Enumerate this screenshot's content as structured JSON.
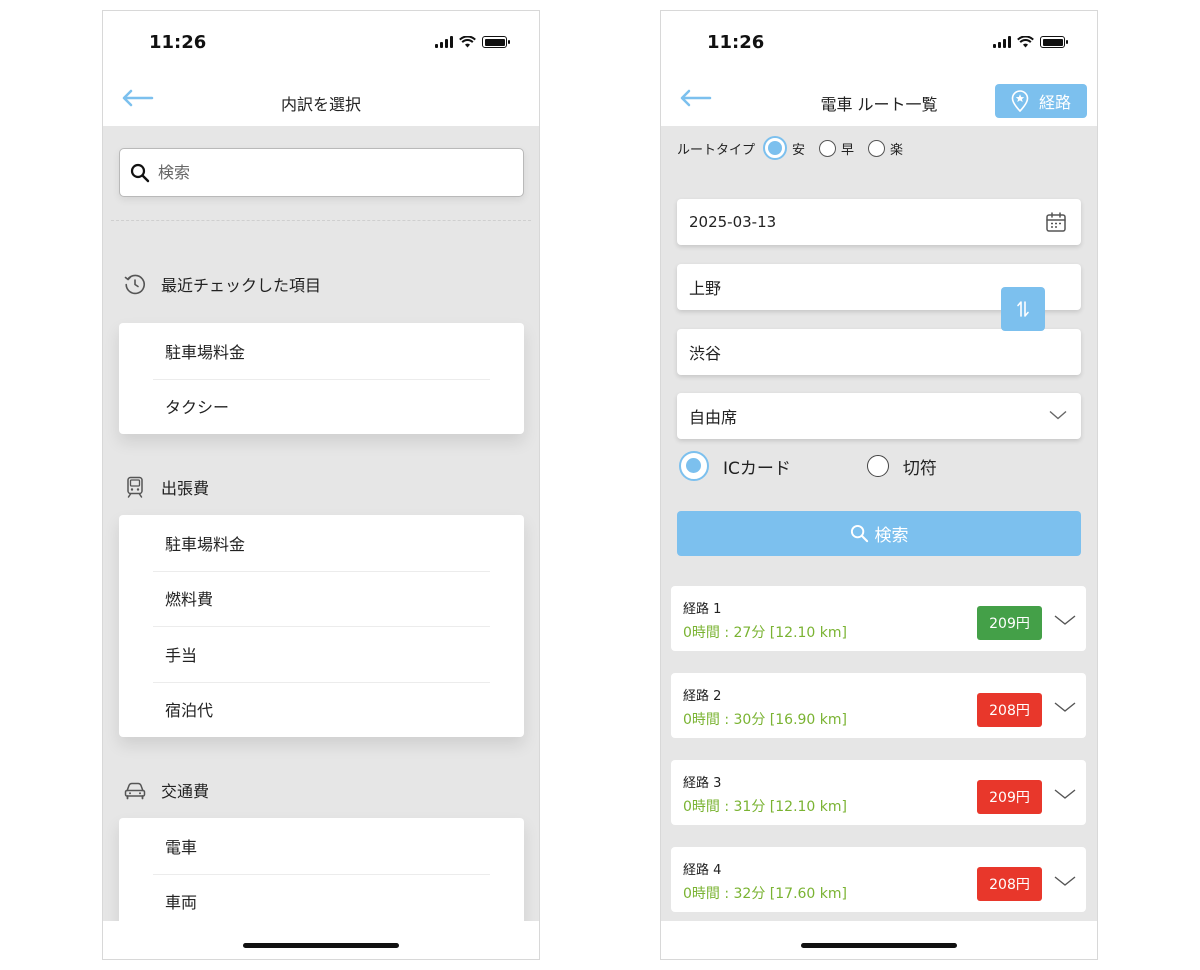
{
  "status_time": "11:26",
  "left": {
    "title": "内訳を選択",
    "search_placeholder": "検索",
    "recent": {
      "heading": "最近チェックした項目",
      "items": [
        "駐車場料金",
        "タクシー"
      ]
    },
    "business_trip": {
      "heading": "出張費",
      "items": [
        "駐車場料金",
        "燃料費",
        "手当",
        "宿泊代"
      ]
    },
    "transport": {
      "heading": "交通費",
      "items": [
        "電車",
        "車両"
      ]
    }
  },
  "right": {
    "title": "電車 ルート一覧",
    "route_button": "経路",
    "route_type": {
      "label": "ルートタイプ",
      "options": [
        "安",
        "早",
        "楽"
      ],
      "selected": "安"
    },
    "date": "2025-03-13",
    "from": "上野",
    "to": "渋谷",
    "seat": "自由席",
    "card_types": [
      "ICカード",
      "切符"
    ],
    "selected_card_type": "ICカード",
    "search_button": "検索",
    "routes": [
      {
        "name": "経路 1",
        "meta": "0時間 : 27分 [12.10 km]",
        "price": "209円",
        "price_color": "#44a048"
      },
      {
        "name": "経路 2",
        "meta": "0時間 : 30分 [16.90 km]",
        "price": "208円",
        "price_color": "#e8372b"
      },
      {
        "name": "経路 3",
        "meta": "0時間 : 31分 [12.10 km]",
        "price": "209円",
        "price_color": "#e8372b"
      },
      {
        "name": "経路 4",
        "meta": "0時間 : 32分 [17.60 km]",
        "price": "208円",
        "price_color": "#e8372b"
      }
    ]
  },
  "colors": {
    "accent": "#7cc0ee",
    "green_text": "#7ab332",
    "price_green": "#44a048",
    "price_red": "#e8372b"
  }
}
